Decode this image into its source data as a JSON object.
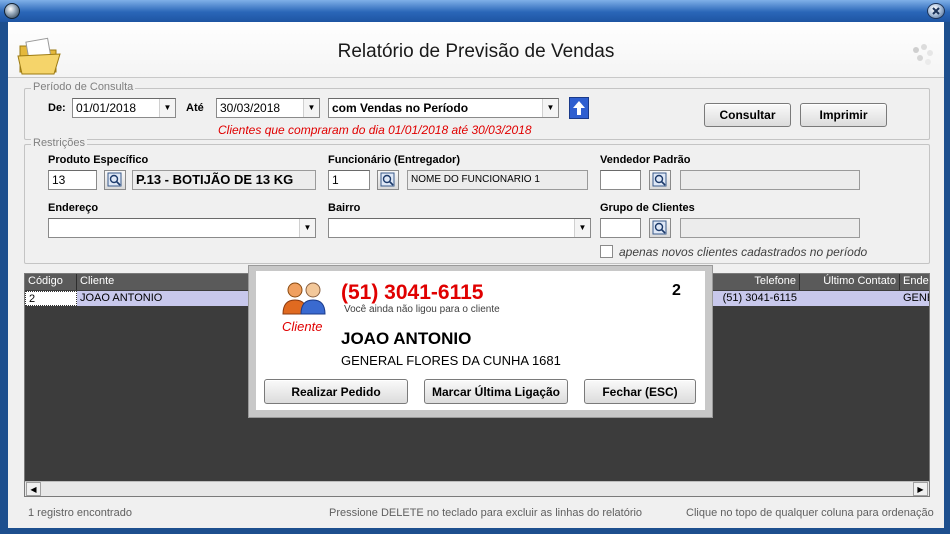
{
  "window": {
    "title": "Relatório de Previsão de Vendas"
  },
  "periodo": {
    "legend": "Período de Consulta",
    "de_label": "De:",
    "de_value": "01/01/2018",
    "ate_label": "Até",
    "ate_value": "30/03/2018",
    "tipo_value": "com Vendas no Período",
    "info": "Clientes que compraram do dia 01/01/2018 até 30/03/2018",
    "consultar_label": "Consultar",
    "imprimir_label": "Imprimir"
  },
  "restricoes": {
    "legend": "Restrições",
    "produto_label": "Produto Específico",
    "produto_code": "13",
    "produto_name": "P.13 - BOTIJÃO DE 13 KG",
    "funcionario_label": "Funcionário (Entregador)",
    "funcionario_code": "1",
    "funcionario_name": "NOME DO FUNCIONARIO 1",
    "vendedor_label": "Vendedor Padrão",
    "vendedor_code": "",
    "vendedor_name": "",
    "endereco_label": "Endereço",
    "endereco_value": "",
    "bairro_label": "Bairro",
    "bairro_value": "",
    "grupo_label": "Grupo de Clientes",
    "grupo_code": "",
    "grupo_name": "",
    "novos_label": "apenas novos clientes cadastrados no período",
    "novos_checked": false
  },
  "grid": {
    "columns": [
      "Código",
      "Cliente",
      "Telefone",
      "Último Contato",
      "Ender"
    ],
    "rows": [
      {
        "codigo": "2",
        "cliente": "JOAO ANTONIO",
        "telefone": "(51) 3041-6115",
        "ultimo_contato": "",
        "endereco": "GENE"
      }
    ]
  },
  "status": {
    "count": "1 registro encontrado",
    "hint_delete": "Pressione DELETE no teclado para excluir as linhas do relatório",
    "hint_sort": "Clique no topo de qualquer coluna para ordenação"
  },
  "popup": {
    "role": "Cliente",
    "phone": "(51) 3041-6115",
    "count": "2",
    "note": "Você ainda não ligou para o cliente",
    "name": "JOAO ANTONIO",
    "address": "GENERAL FLORES DA CUNHA 1681",
    "btn_pedido": "Realizar Pedido",
    "btn_ligacao": "Marcar Última Ligação",
    "btn_fechar": "Fechar (ESC)"
  },
  "colors": {
    "accent_red": "#e00000",
    "title_blue": "#2a66b8",
    "row_selected": "#c8c8ec",
    "grid_bg": "#3c3c3c"
  },
  "icons": [
    "folder-icon",
    "people-icon",
    "magnifier-icon",
    "up-arrow-icon",
    "chevron-down-icon",
    "close-icon"
  ]
}
